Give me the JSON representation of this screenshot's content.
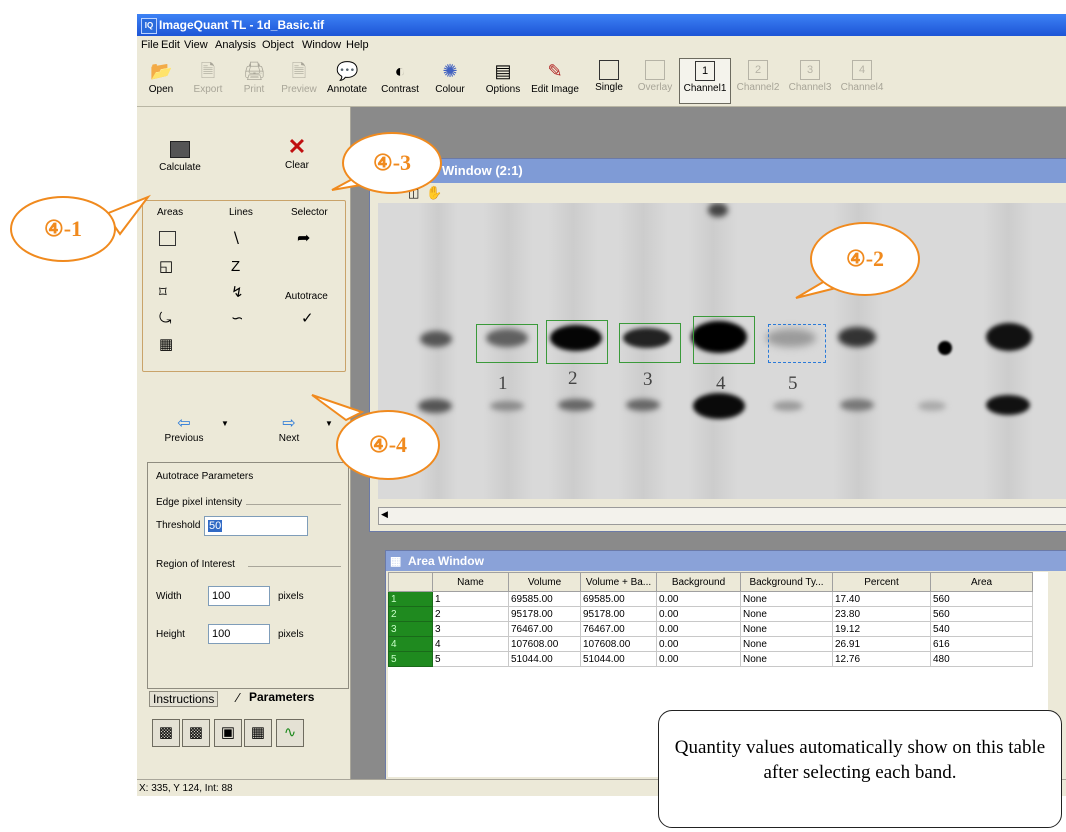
{
  "window": {
    "title": "ImageQuant TL - 1d_Basic.tif"
  },
  "menu": [
    "File",
    "Edit",
    "View",
    "Analysis",
    "Object",
    "Window",
    "Help"
  ],
  "toolbar": [
    {
      "label": "Open",
      "icon": "open-folder-icon"
    },
    {
      "label": "Export",
      "icon": "export-icon"
    },
    {
      "label": "Print",
      "icon": "printer-icon"
    },
    {
      "label": "Preview",
      "icon": "preview-icon"
    },
    {
      "label": "Annotate",
      "icon": "speech-bubble-icon"
    },
    {
      "label": "Contrast",
      "icon": "contrast-icon"
    },
    {
      "label": "Colour",
      "icon": "palette-icon"
    },
    {
      "label": "Options",
      "icon": "options-icon"
    },
    {
      "label": "Edit Image",
      "icon": "edit-image-icon"
    },
    {
      "label": "Single",
      "icon": "single-view-icon"
    },
    {
      "label": "Overlay",
      "icon": "overlay-icon"
    },
    {
      "label": "Channel1",
      "num": "1"
    },
    {
      "label": "Channel2",
      "num": "2"
    },
    {
      "label": "Channel3",
      "num": "3"
    },
    {
      "label": "Channel4",
      "num": "4"
    }
  ],
  "left_panel": {
    "calculate": "Calculate",
    "clear": "Clear",
    "areas": "Areas",
    "lines": "Lines",
    "selector": "Selector",
    "autotrace": "Autotrace",
    "previous": "Previous",
    "next": "Next"
  },
  "params": {
    "title": "Autotrace Parameters",
    "edge_group": "Edge pixel intensity",
    "threshold_label": "Threshold",
    "threshold_value": "50",
    "roi_group": "Region of Interest",
    "width_label": "Width",
    "width_value": "100",
    "height_label": "Height",
    "height_value": "100",
    "unit": "pixels"
  },
  "tabs": [
    "Instructions",
    "Parameters"
  ],
  "status": "X: 335, Y 124, Int: 88",
  "image_window": {
    "title": "Window (2:1)",
    "band_labels": [
      "1",
      "2",
      "3",
      "4",
      "5"
    ]
  },
  "area_window": {
    "title": "Area Window",
    "columns": [
      "Name",
      "Volume",
      "Volume + Ba...",
      "Background",
      "Background Ty...",
      "Percent",
      "Area"
    ],
    "rows": [
      {
        "id": "1",
        "name": "1",
        "volume": "69585.00",
        "vol_bg": "69585.00",
        "background": "0.00",
        "bg_type": "None",
        "percent": "17.40",
        "area": "560"
      },
      {
        "id": "2",
        "name": "2",
        "volume": "95178.00",
        "vol_bg": "95178.00",
        "background": "0.00",
        "bg_type": "None",
        "percent": "23.80",
        "area": "560"
      },
      {
        "id": "3",
        "name": "3",
        "volume": "76467.00",
        "vol_bg": "76467.00",
        "background": "0.00",
        "bg_type": "None",
        "percent": "19.12",
        "area": "540"
      },
      {
        "id": "4",
        "name": "4",
        "volume": "107608.00",
        "vol_bg": "107608.00",
        "background": "0.00",
        "bg_type": "None",
        "percent": "26.91",
        "area": "616"
      },
      {
        "id": "5",
        "name": "5",
        "volume": "51044.00",
        "vol_bg": "51044.00",
        "background": "0.00",
        "bg_type": "None",
        "percent": "12.76",
        "area": "480"
      }
    ]
  },
  "callouts": {
    "c1": "④-1",
    "c2": "④-2",
    "c3": "④-3",
    "c4": "④-4"
  },
  "note": "Quantity values automatically show on this table after selecting each band.",
  "colors": {
    "callout": "#f08a1e",
    "roi": "#3a9a3a",
    "selected_roi": "#2a7ad8",
    "titlebar": "#1d55d6"
  }
}
